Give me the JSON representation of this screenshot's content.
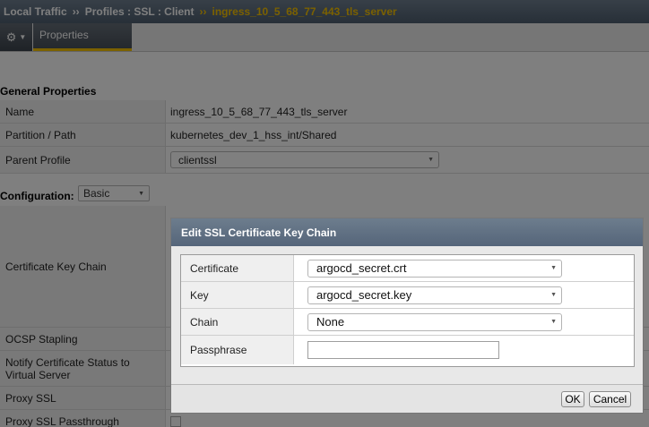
{
  "breadcrumb": {
    "items": [
      "Local Traffic",
      "Profiles : SSL : Client",
      "ingress_10_5_68_77_443_tls_server"
    ],
    "separator": "››"
  },
  "tabs": {
    "active": "Properties"
  },
  "general": {
    "title": "General Properties",
    "rows": [
      {
        "label": "Name",
        "value": "ingress_10_5_68_77_443_tls_server"
      },
      {
        "label": "Partition / Path",
        "value": "kubernetes_dev_1_hss_int/Shared"
      },
      {
        "label": "Parent Profile",
        "value": "clientssl"
      }
    ]
  },
  "configuration": {
    "title": "Configuration:",
    "mode": "Basic",
    "rows": [
      {
        "label": "Certificate Key Chain"
      },
      {
        "label": "OCSP Stapling"
      },
      {
        "label": "Notify Certificate Status to Virtual Server"
      },
      {
        "label": "Proxy SSL"
      },
      {
        "label": "Proxy SSL Passthrough"
      }
    ]
  },
  "dialog": {
    "title": "Edit SSL Certificate Key Chain",
    "fields": {
      "certificate": {
        "label": "Certificate",
        "value": "argocd_secret.crt"
      },
      "key": {
        "label": "Key",
        "value": "argocd_secret.key"
      },
      "chain": {
        "label": "Chain",
        "value": "None"
      },
      "passphrase": {
        "label": "Passphrase",
        "value": ""
      }
    },
    "ok_label": "OK",
    "cancel_label": "Cancel"
  },
  "colors": {
    "accent": "#f6c200",
    "header_bg": "#5a6a7a"
  }
}
